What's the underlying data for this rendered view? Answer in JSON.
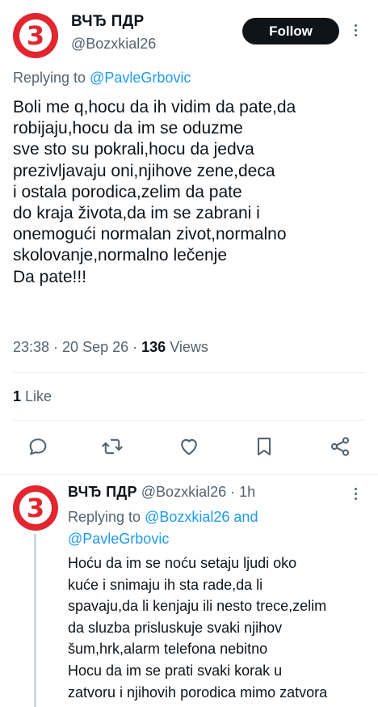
{
  "main_tweet": {
    "display_name": "ВЧЂ ПДР",
    "avatar_digit": "3",
    "handle": "@Bozxkial26",
    "follow_label": "Follow",
    "replying_prefix": "Replying to",
    "replying_to": "@PavleGrbovic",
    "text": "Boli me q,hocu da ih vidim da pate,da robijaju,hocu da im se oduzme\nsve sto su pokrali,hocu da jedva\nprezivljavaju oni,njihove zene,deca\ni ostala porodica,zelim da pate\ndo kraja života,da im se zabrani i\nonemogući normalan zivot,normalno\nskolovanje,normalno lečenje\nDa pate!!!",
    "time": "23:38",
    "date": "20 Sep 26",
    "views_count": "136",
    "views_label": "Views",
    "likes_count": "1",
    "likes_label": "Like"
  },
  "actions": {
    "icons": [
      "reply-icon",
      "retweet-icon",
      "like-icon",
      "bookmark-icon",
      "share-icon"
    ]
  },
  "reply_tweet": {
    "display_name": "ВЧЂ ПДР",
    "avatar_digit": "3",
    "handle": "@Bozxkial26",
    "time_ago": "1h",
    "replying_prefix": "Replying to",
    "replying_to_1": "@Bozxkial26",
    "replying_and": "and",
    "replying_to_2": "@PavleGrbovic",
    "text": "Hoću da im se noću setaju ljudi oko\nkuće i snimaju ih sta rade,da li\nspavaju,da li kenjaju ili nesto trece,zelim\nda sluzba prisluskuje svaki njihov\nšum,hrk,alarm telefona nebitno\nHocu da im se prati svaki korak u\nzatvoru i njihovih porodica mimo zatvora"
  },
  "colors": {
    "avatar_red": "#e2262f",
    "link_blue": "#1d9bf0",
    "muted_gray": "#536471",
    "text_dark": "#0f1419"
  }
}
